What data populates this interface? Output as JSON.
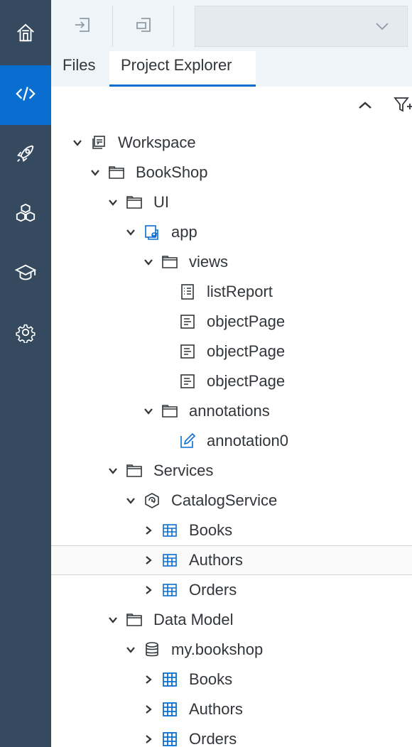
{
  "activity_bar": {
    "items": [
      {
        "icon": "home-icon"
      },
      {
        "icon": "code-icon",
        "active": true
      },
      {
        "icon": "rocket-icon"
      },
      {
        "icon": "cubes-icon"
      },
      {
        "icon": "graduation-cap-icon"
      },
      {
        "icon": "gear-icon"
      }
    ]
  },
  "toolbar": {
    "buttons": [
      {
        "icon": "import-icon"
      },
      {
        "icon": "export-icon"
      }
    ],
    "select": {
      "value": "",
      "icon": "chevron-down-icon"
    }
  },
  "tabs": [
    {
      "label": "Files",
      "active": false
    },
    {
      "label": "Project Explorer",
      "active": true
    }
  ],
  "explorer_actions": {
    "collapse_icon": "chevron-up-icon",
    "filter_icon": "filter-add-icon"
  },
  "tree": [
    {
      "label": "Workspace",
      "icon": "workspace-icon",
      "expanded": true
    },
    {
      "label": "BookShop",
      "icon": "folder-icon",
      "expanded": true
    },
    {
      "label": "UI",
      "icon": "folder-icon",
      "expanded": true
    },
    {
      "label": "app",
      "icon": "app-icon",
      "expanded": true
    },
    {
      "label": "views",
      "icon": "folder-icon",
      "expanded": true
    },
    {
      "label": "listReport",
      "icon": "list-page-icon"
    },
    {
      "label": "objectPage",
      "icon": "object-page-icon"
    },
    {
      "label": "objectPage",
      "icon": "object-page-icon"
    },
    {
      "label": "objectPage",
      "icon": "object-page-icon"
    },
    {
      "label": "annotations",
      "icon": "folder-icon",
      "expanded": true
    },
    {
      "label": "annotation0",
      "icon": "edit-icon"
    },
    {
      "label": "Services",
      "icon": "folder-icon",
      "expanded": true
    },
    {
      "label": "CatalogService",
      "icon": "service-icon",
      "expanded": true
    },
    {
      "label": "Books",
      "icon": "entity-table-icon",
      "expanded": false
    },
    {
      "label": "Authors",
      "icon": "entity-table-icon",
      "expanded": false,
      "selected": true
    },
    {
      "label": "Orders",
      "icon": "entity-table-icon",
      "expanded": false
    },
    {
      "label": "Data Model",
      "icon": "folder-icon",
      "expanded": true
    },
    {
      "label": "my.bookshop",
      "icon": "database-icon",
      "expanded": true
    },
    {
      "label": "Books",
      "icon": "table-icon",
      "expanded": false
    },
    {
      "label": "Authors",
      "icon": "table-icon",
      "expanded": false
    },
    {
      "label": "Orders",
      "icon": "table-icon",
      "expanded": false
    }
  ],
  "colors": {
    "activity_bar": "#354a5f",
    "active": "#0a6ed1",
    "toolbar": "#eff4f9",
    "text": "#32363a"
  }
}
